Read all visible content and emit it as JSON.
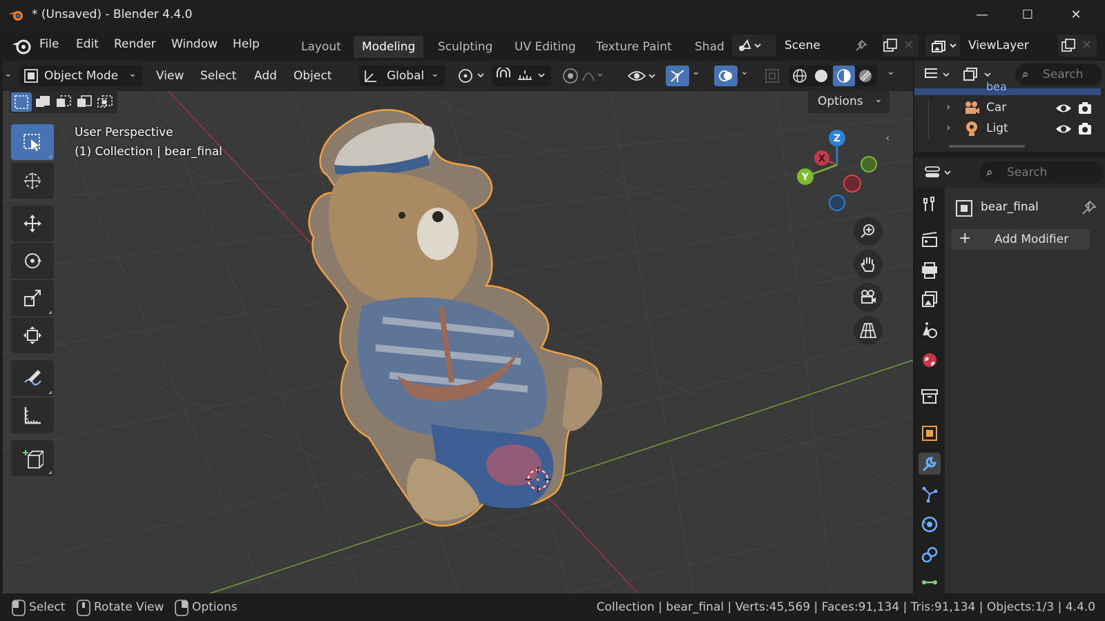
{
  "window": {
    "title": "* (Unsaved) - Blender 4.4.0",
    "minimize": "—",
    "maximize": "☐",
    "close": "✕"
  },
  "menu": {
    "items": [
      "File",
      "Edit",
      "Render",
      "Window",
      "Help"
    ]
  },
  "workspaces": {
    "tabs": [
      "Layout",
      "Modeling",
      "Sculpting",
      "UV Editing",
      "Texture Paint",
      "Shad"
    ],
    "active": "Modeling"
  },
  "scene": {
    "name": "Scene"
  },
  "view_layer": {
    "name": "ViewLayer"
  },
  "viewport_header": {
    "mode": "Object Mode",
    "menus": [
      "View",
      "Select",
      "Add",
      "Object"
    ],
    "transform_orientation": "Global",
    "options_label": "Options"
  },
  "viewport": {
    "perspective_label": "User Perspective",
    "collection_label": "(1) Collection | bear_final",
    "gizmo_axes": {
      "z": "Z",
      "x": "X",
      "y": "Y"
    },
    "colors": {
      "x": "#c8364a",
      "y": "#7dbb2f",
      "z": "#2c82d8",
      "outline": "#f0a040",
      "bg": "#3a3a3a"
    }
  },
  "outliner": {
    "search_placeholder": "Search",
    "rows": [
      {
        "label": "bea",
        "icon": "mesh-icon",
        "selected": true
      },
      {
        "label": "Car",
        "icon": "camera-icon",
        "selected": false
      },
      {
        "label": "Ligt",
        "icon": "light-icon",
        "selected": false
      }
    ]
  },
  "properties": {
    "search_placeholder": "Search",
    "object_name": "bear_final",
    "add_modifier_label": "Add Modifier",
    "active_tab": "modifier-tab"
  },
  "statusbar": {
    "left": [
      {
        "key": "mouse-left-icon",
        "label": "Select"
      },
      {
        "key": "mouse-middle-icon",
        "label": "Rotate View"
      },
      {
        "key": "mouse-right-icon",
        "label": "Options"
      }
    ],
    "stats": "Collection | bear_final | Verts:45,569 | Faces:91,134 | Tris:91,134 | Objects:1/3 | 4.4.0"
  },
  "accent": "#4772b3",
  "orange": "#f0a040"
}
